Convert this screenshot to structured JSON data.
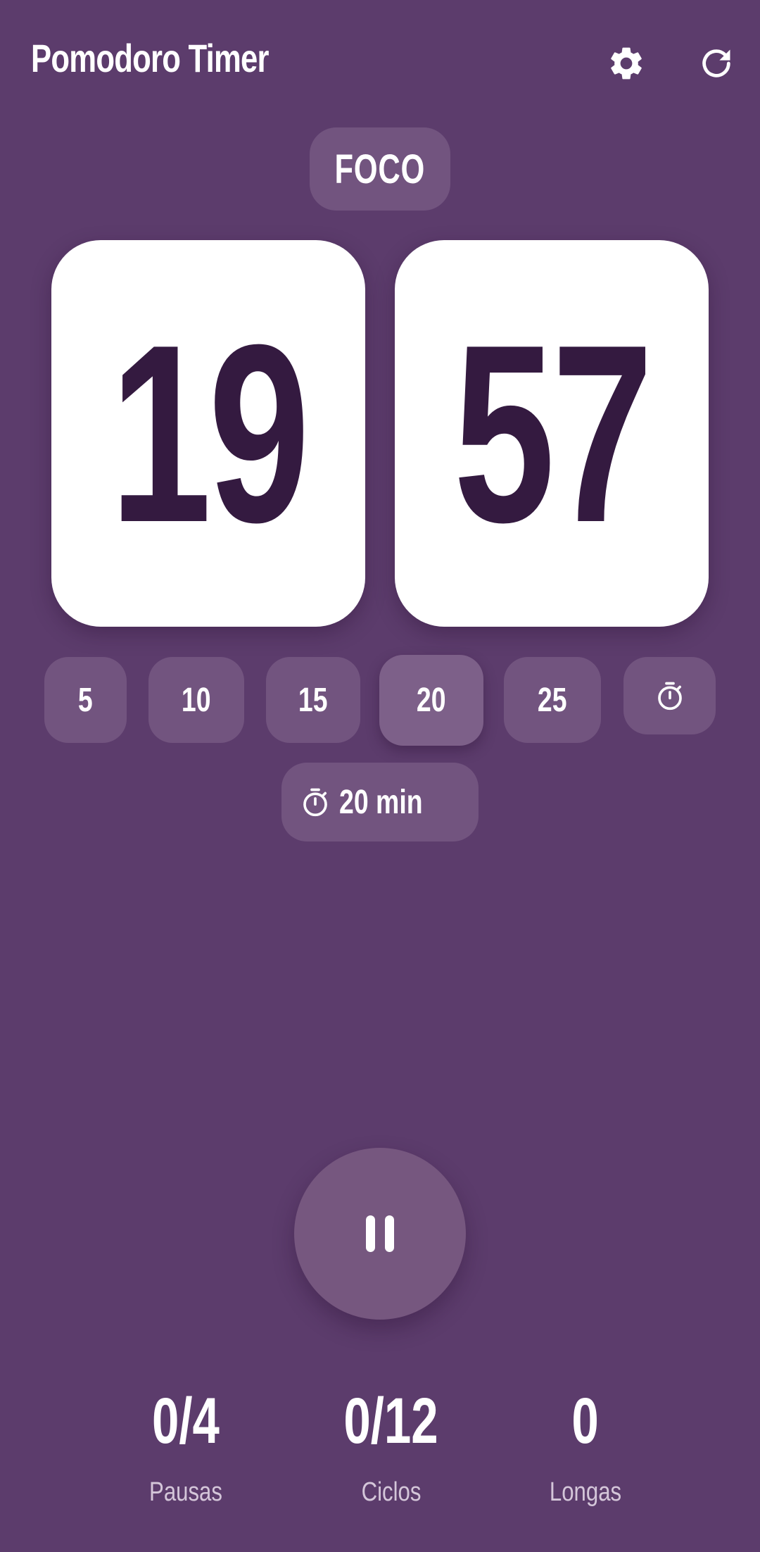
{
  "header": {
    "title": "Pomodoro Timer",
    "settings_icon": "gear-icon",
    "reset_icon": "refresh-icon"
  },
  "mode": {
    "label": "FOCO"
  },
  "timer": {
    "minutes": "19",
    "seconds": "57"
  },
  "presets": {
    "items": [
      {
        "label": "5"
      },
      {
        "label": "10"
      },
      {
        "label": "15"
      },
      {
        "label": "20",
        "selected": true
      },
      {
        "label": "25"
      }
    ],
    "custom_icon": "stopwatch-icon"
  },
  "duration": {
    "icon": "stopwatch-icon",
    "label": "20 min"
  },
  "controls": {
    "pause_icon": "pause-icon"
  },
  "stats": [
    {
      "value": "0/4",
      "caption": "Pausas"
    },
    {
      "value": "0/12",
      "caption": "Ciclos"
    },
    {
      "value": "0",
      "caption": "Longas"
    }
  ],
  "colors": {
    "background": "#5c3c6c",
    "chip": "#72547f",
    "card": "#ffffff",
    "digit": "#341a40",
    "caption": "#d4c6d9"
  }
}
